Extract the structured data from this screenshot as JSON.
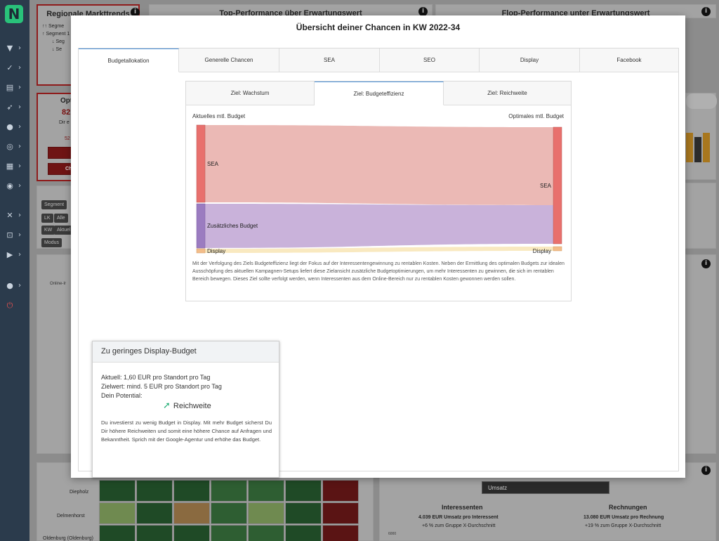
{
  "sidebar": {
    "logo": "N",
    "items": [
      {
        "icon": "filter-icon",
        "glyph": "▼"
      },
      {
        "icon": "check-icon",
        "glyph": "✓"
      },
      {
        "icon": "document-icon",
        "glyph": "▤"
      },
      {
        "icon": "rocket-icon",
        "glyph": "➶"
      },
      {
        "icon": "lightbulb-icon",
        "glyph": "●"
      },
      {
        "icon": "target-icon",
        "glyph": "◎"
      },
      {
        "icon": "table-icon",
        "glyph": "▦"
      },
      {
        "icon": "eye-icon",
        "glyph": "◉"
      },
      {
        "icon": "tools-icon",
        "glyph": "✕"
      },
      {
        "icon": "lock-icon",
        "glyph": "⊡"
      },
      {
        "icon": "play-icon",
        "glyph": "▶"
      },
      {
        "icon": "user-icon",
        "glyph": "●"
      },
      {
        "icon": "power-icon",
        "glyph": "⏻"
      }
    ]
  },
  "background": {
    "card1_title": "Regionale Markttrends",
    "card1_rows": [
      "↑↑ Segme",
      "↑ Segment 1",
      "↓ Seg",
      "↓ Se"
    ],
    "card2_title": "Top-Performance über Erwartungswert",
    "card3_title": "Flop-Performance unter Erwartungswert",
    "opt_title": "Opt",
    "opt_value": "82",
    "opt_sub": "Dir e",
    "opt_num": "52",
    "opt_btn": "Ch",
    "filter_buttons": [
      "Segment",
      "LK",
      "Alle",
      "KW",
      "Aktuel",
      "Modus"
    ],
    "map_label": "Online-Ir",
    "heatmap_labels": [
      "Diepholz",
      "Delmenhorst",
      "Oldenburg (Oldenburg)"
    ],
    "dropdown": "Umsatz",
    "stat1_title": "Interessenten",
    "stat1_value": "4.039 EUR Umsatz pro Interessent",
    "stat1_sub": "+6 % zum Gruppe X-Durchschnitt",
    "stat2_title": "Rechnungen",
    "stat2_value": "13.080 EUR Umsatz pro Rechnung",
    "stat2_sub": "+19 % zum Gruppe X-Durchschnitt",
    "axis_tick": "6000"
  },
  "modal": {
    "title": "Übersicht deiner Chancen in KW 2022-34",
    "tabs": [
      "Budgetallokation",
      "Generelle Chancen",
      "SEA",
      "SEO",
      "Display",
      "Facebook"
    ],
    "subtabs": [
      "Ziel: Wachstum",
      "Ziel: Budgeteffizienz",
      "Ziel: Reichweite"
    ],
    "label_current": "Aktuelles mtl. Budget",
    "label_optimal": "Optimales mtl. Budget",
    "sankey": {
      "left_nodes": [
        "SEA",
        "Zusätzliches Budget",
        "Display"
      ],
      "right_nodes": [
        "SEA",
        "Display"
      ]
    },
    "description": "Mit der Verfolgung des Ziels Budgeteffizienz liegt der Fokus auf der Interessentengewinnung zu rentablen Kosten. Neben der Ermittlung des optimalen Budgets zur idealen Ausschöpfung des aktuellen Kampagnen-Setups liefert diese Zielansicht zusätzliche Budgetoptimierungen, um mehr Interessenten zu gewinnen, die sich im rentablen Bereich bewegen. Dieses Ziel sollte verfolgt werden, wenn Interessenten aus dem Online-Bereich nur zu rentablen Kosten gewonnen werden sollen.",
    "alert": {
      "title": "Zu geringes Display-Budget",
      "current": "Aktuell:  1,60 EUR pro Standort pro Tag",
      "target": "Zielwert:  mind. 5 EUR pro Standort pro Tag",
      "potential_label": "Dein Potential:",
      "potential_value": "Reichweite",
      "text": "Du investierst zu wenig Budget in Display. Mit mehr Budget sicherst Du Dir höhere Reichweiten und somit eine höhere Chance auf Anfragen und Bekanntheit. Sprich mit der Google-Agentur und erhöhe das Budget."
    }
  },
  "colors": {
    "sea_flow": "#ebb9b5",
    "sea_node": "#e8706d",
    "extra_flow": "#c9b2da",
    "extra_node": "#9b7cc0",
    "display_flow": "#f9e9c0",
    "display_node": "#f3bd8a",
    "accent_green": "#29b07a"
  }
}
